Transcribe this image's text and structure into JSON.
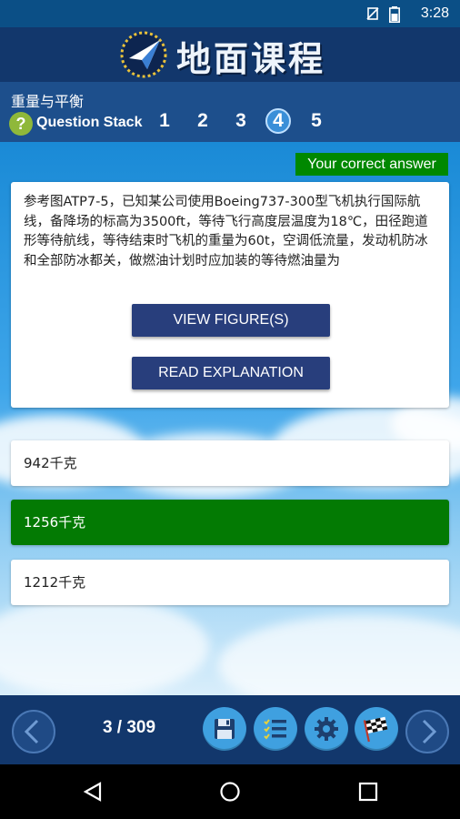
{
  "status_bar": {
    "time": "3:28"
  },
  "header": {
    "app_title": "地面课程"
  },
  "subheader": {
    "topic": "重量与平衡",
    "help_symbol": "?",
    "question_stack_label": "Question Stack",
    "stack_numbers": [
      "1",
      "2",
      "3",
      "4",
      "5"
    ],
    "active_number": "4"
  },
  "correct_label": "Your correct answer",
  "question": {
    "text": "参考图ATP7-5，已知某公司使用Boeing737-300型飞机执行国际航线，备降场的标高为3500ft，等待飞行高度层温度为18℃，田径跑道形等待航线，等待结束时飞机的重量为60t，空调低流量，发动机防冰和全部防冰都关，做燃油计划时应加装的等待燃油量为",
    "view_figure_label": "VIEW FIGURE(S)",
    "read_explanation_label": "READ EXPLANATION"
  },
  "answers": [
    {
      "text": "942千克",
      "state": "normal"
    },
    {
      "text": "1256千克",
      "state": "correct"
    },
    {
      "text": "1212千克",
      "state": "normal"
    }
  ],
  "footer": {
    "counter": "3 / 309"
  },
  "colors": {
    "header_bg": "#12376c",
    "correct_green": "#037a03",
    "button_bg": "#283e7c",
    "tool_bg": "#3fa0e0"
  },
  "icons": [
    "sim-off-icon",
    "battery-icon",
    "logo-plane-icon",
    "help-icon",
    "star-icon",
    "prev-arrow-icon",
    "save-icon",
    "checklist-icon",
    "settings-icon",
    "finish-flag-icon",
    "next-arrow-icon",
    "back-nav-icon",
    "home-nav-icon",
    "recents-nav-icon"
  ]
}
